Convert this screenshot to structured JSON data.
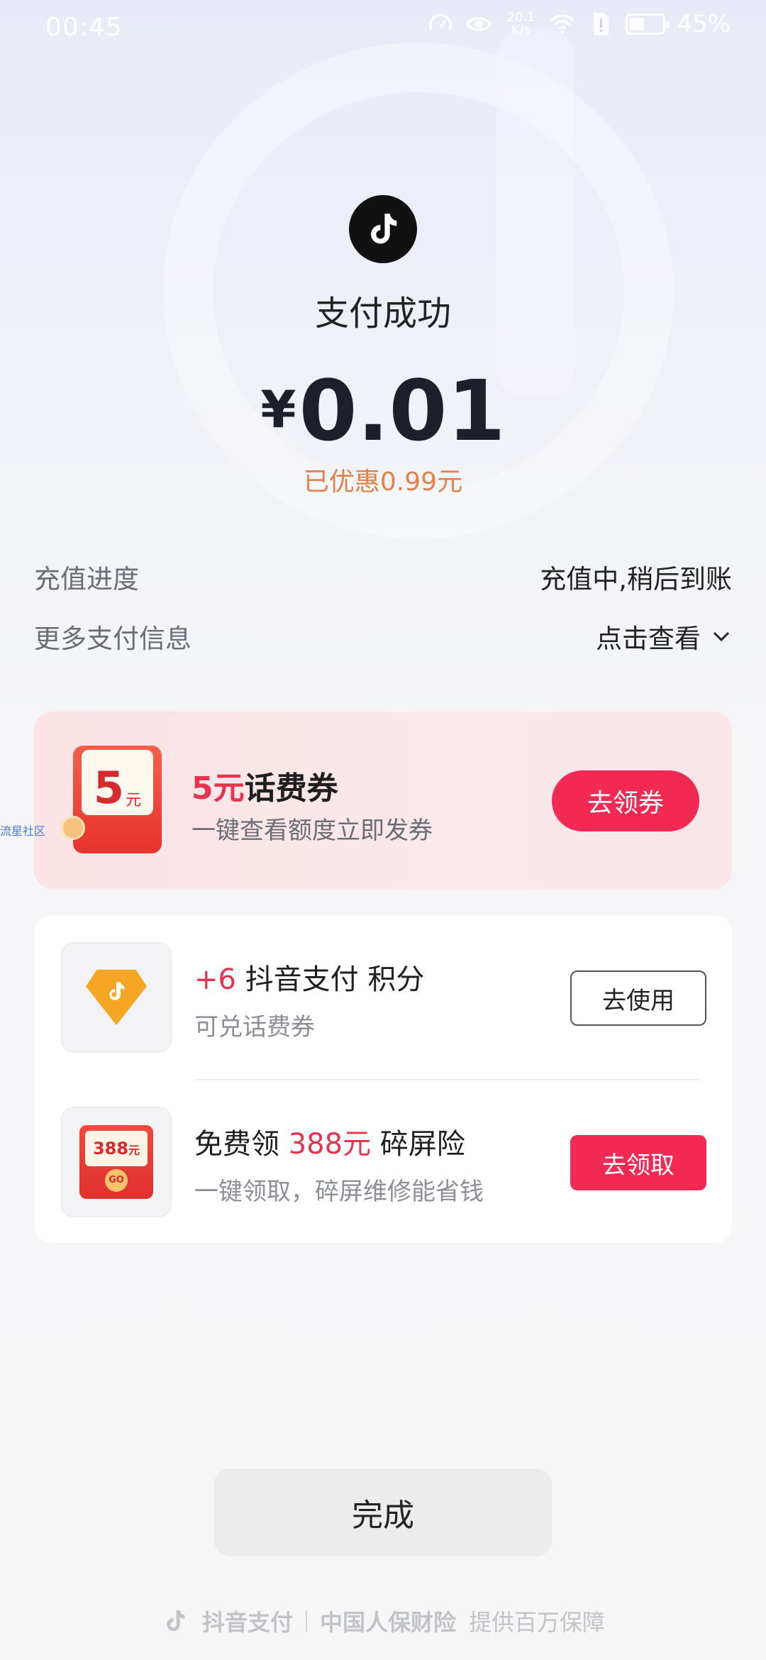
{
  "status_bar": {
    "time": "00:45",
    "net_speed_value": "20.1",
    "net_speed_unit": "K/s",
    "battery_percent": "45%",
    "battery_level": 0.45
  },
  "header": {
    "title": "支付成功",
    "currency_symbol": "¥",
    "amount": "0.01",
    "discount": "已优惠0.99元"
  },
  "info": {
    "progress_label": "充值进度",
    "progress_value": "充值中,稍后到账",
    "more_label": "更多支付信息",
    "more_value": "点击查看"
  },
  "promo": {
    "envelope_amount": "5",
    "envelope_unit": "元",
    "watermark": "流星社区",
    "title_highlight": "5元",
    "title_rest": "话费券",
    "subtitle": "一键查看额度立即发券",
    "button": "去领券"
  },
  "rewards": [
    {
      "title_highlight": "+6",
      "title_rest": " 抖音支付 积分",
      "subtitle": "可兑话费券",
      "button": "去使用"
    },
    {
      "title_prefix": "免费领 ",
      "title_highlight": "388元",
      "title_rest": " 碎屏险",
      "subtitle": "一键领取，碎屏维修能省钱",
      "button": "去领取",
      "icon_amount": "388",
      "icon_unit": "元",
      "icon_go": "GO"
    }
  ],
  "done_button": "完成",
  "footer": {
    "brand": "抖音支付",
    "partner": "中国人保财险",
    "guarantee": "提供百万保障"
  },
  "colors": {
    "accent_pink": "#f22a53",
    "highlight_red": "#e8334f",
    "discount_orange": "#e0814a",
    "points_yellow": "#f5a623"
  }
}
